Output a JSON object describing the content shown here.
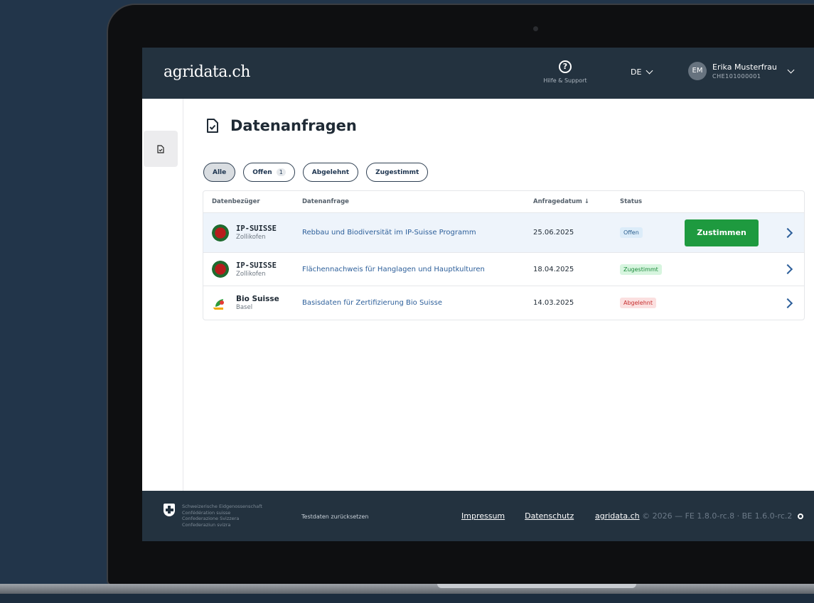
{
  "header": {
    "logo": "agridata.ch",
    "help_label": "Hilfe & Support",
    "language": "DE",
    "user": {
      "initials": "EM",
      "name": "Erika Musterfrau",
      "id": "CHE101000001"
    }
  },
  "page": {
    "title": "Datenanfragen"
  },
  "filters": [
    {
      "label": "Alle",
      "active": true
    },
    {
      "label": "Offen",
      "count": "1"
    },
    {
      "label": "Abgelehnt"
    },
    {
      "label": "Zugestimmt"
    }
  ],
  "table": {
    "headers": {
      "provider": "Datenbezüger",
      "request": "Datenanfrage",
      "date": "Anfragedatum",
      "status": "Status"
    },
    "rows": [
      {
        "provider": "IP-SUISSE",
        "city": "Zollikofen",
        "request": "Rebbau und Biodiversität im IP-Suisse Programm",
        "date": "25.06.2025",
        "status": "Offen",
        "action": "Zustimmen"
      },
      {
        "provider": "IP-SUISSE",
        "city": "Zollikofen",
        "request": "Flächennachweis für Hanglagen und Hauptkulturen",
        "date": "18.04.2025",
        "status": "Zugestimmt"
      },
      {
        "provider": "Bio Suisse",
        "city": "Basel",
        "request": "Basisdaten für Zertifizierung Bio Suisse",
        "date": "14.03.2025",
        "status": "Abgelehnt"
      }
    ]
  },
  "footer": {
    "confederation": [
      "Schweizerische Eidgenossenschaft",
      "Confédération suisse",
      "Confederazione Svizzera",
      "Confederaziun svizra"
    ],
    "reset": "Testdaten zurücksetzen",
    "impressum": "Impressum",
    "datenschutz": "Datenschutz",
    "brand": "agridata.ch",
    "version": "© 2026 — FE 1.8.0-rc.8 · BE 1.6.0-rc.2"
  },
  "colors": {
    "header_bg": "#23323f",
    "approve": "#1e9a3f",
    "link": "#2d5f9a"
  }
}
